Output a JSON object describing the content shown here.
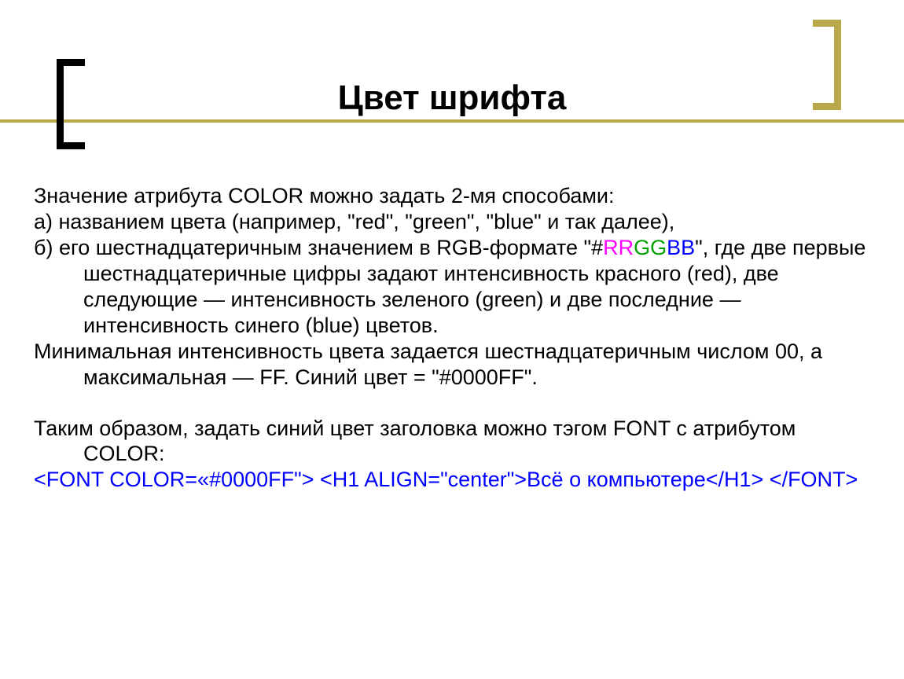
{
  "title": "Цвет шрифта",
  "intro": "Значение атрибута COLOR можно задать 2-мя способами:",
  "option_a": "а) названием цвета (например, \"red\", \"green\", \"blue\" и так далее),",
  "option_b_prefix": "б) его шестнадцатеричным значением в RGB-формате \"#",
  "rr": "RR",
  "gg": "GG",
  "bb": "BB",
  "option_b_suffix": "\", где две первые шестнадцатеричные цифры задают интенсивность красного (red), две следующие — интенсивность зеленого (green) и две последние — интенсивность синего (blue) цветов.",
  "min_max": "Минимальная интенсивность цвета задается шестнадцатеричным числом 00, а максимальная — FF.     Синий цвет = \"#0000FF\".",
  "thus": "Таким образом, задать синий цвет заголовка можно тэгом  FONT с атрибутом COLOR:",
  "code_line1": "<FONT   COLOR=«#0000FF\"> <H1 ALIGN=\"center\">Всё о компьютере</H1> </FONT>"
}
